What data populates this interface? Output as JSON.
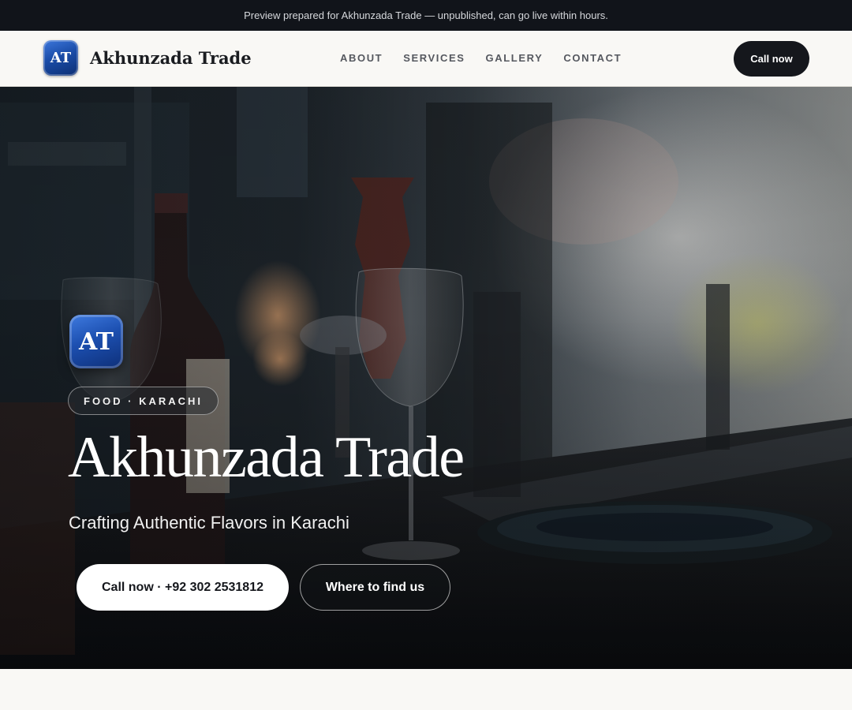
{
  "preview_banner": {
    "text": "Preview prepared for Akhunzada Trade — unpublished, can go live within hours."
  },
  "header": {
    "logo_initials": "AT",
    "brand_name": "Akhunzada Trade",
    "nav_links": [
      {
        "label": "ABOUT"
      },
      {
        "label": "SERVICES"
      },
      {
        "label": "GALLERY"
      },
      {
        "label": "CONTACT"
      }
    ],
    "cta_label": "Call now"
  },
  "hero": {
    "badge_initials": "AT",
    "tag": "FOOD · KARACHI",
    "title": "Akhunzada Trade",
    "subtitle": "Crafting Authentic Flavors in Karachi",
    "primary_button": "Call now · +92 302 2531812",
    "secondary_button": "Where to find us",
    "background_image": "restaurant-table-wine-glasses-photo"
  },
  "colors": {
    "topbar_bg": "#11141a",
    "nav_bg": "#f9f8f5",
    "cta_bg": "#15171c",
    "brand_blue": "#1a4ca8",
    "page_bg": "#f8f7f4"
  }
}
